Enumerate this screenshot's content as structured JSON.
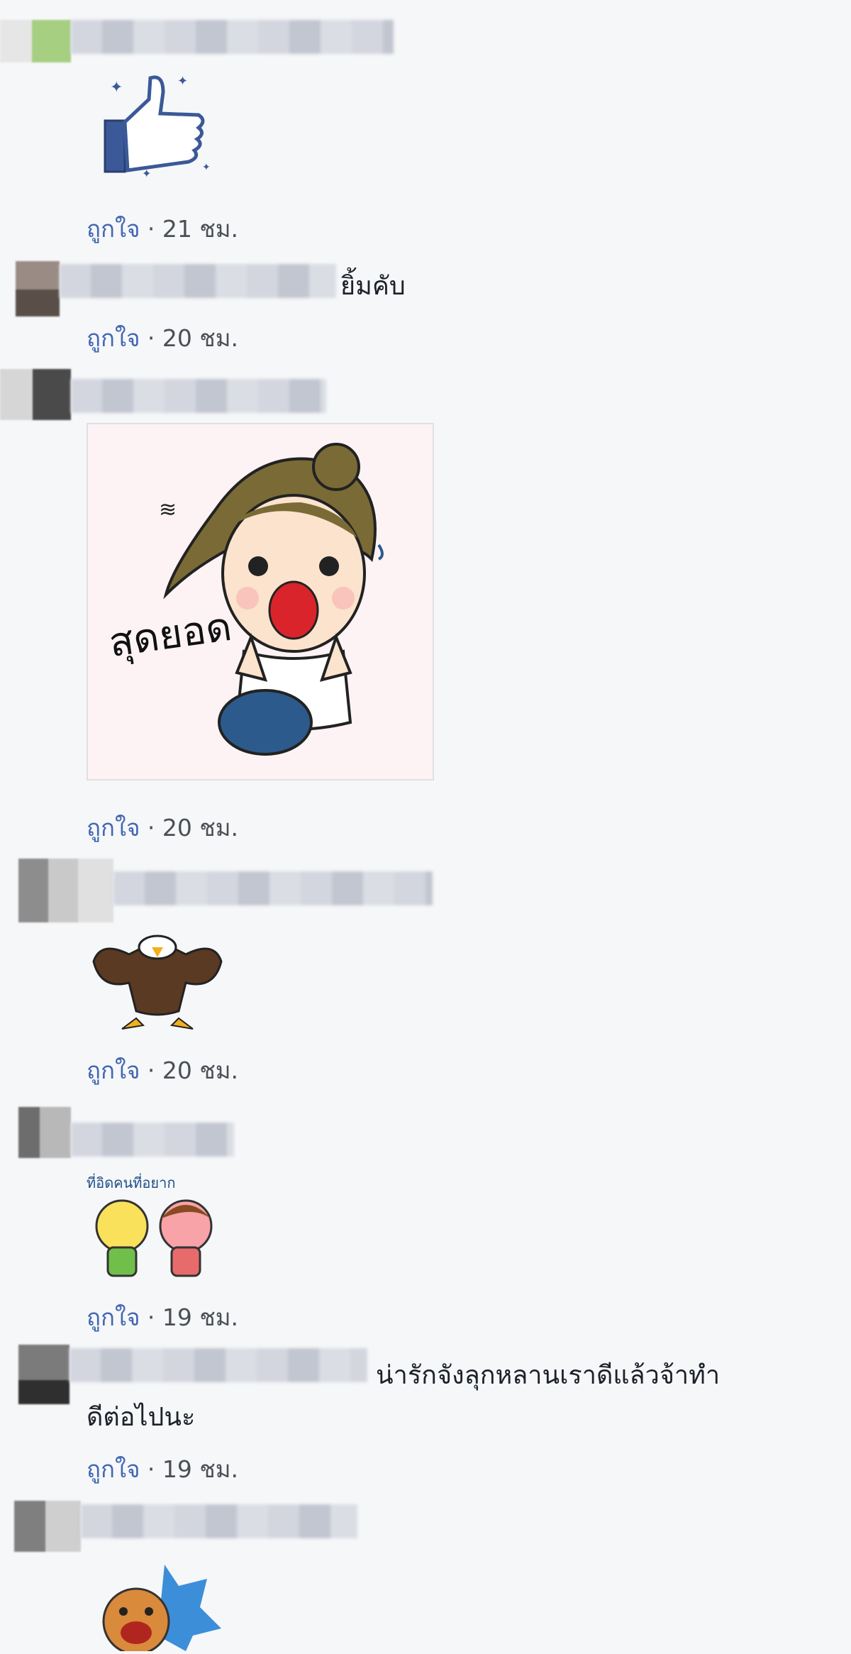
{
  "comments": [
    {
      "text": "",
      "like_label": "ถูกใจ",
      "time": "· 21 ชม.",
      "sticker": "thumbs-up-sticker"
    },
    {
      "text": "ยิ้มคับ",
      "like_label": "ถูกใจ",
      "time": "· 20 ชม."
    },
    {
      "text": "",
      "like_label": "ถูกใจ",
      "time": "· 20 ชม.",
      "sticker": "girl-thumbs-up-sticker",
      "sticker_text": "สุดยอด"
    },
    {
      "text": "",
      "like_label": "ถูกใจ",
      "time": "· 20 ชม.",
      "sticker": "eagle-flexing-sticker"
    },
    {
      "text": "",
      "like_label": "ถูกใจ",
      "time": "· 19 ชม.",
      "sticker": "two-kids-sticker",
      "sticker_text": "ที่อิดคนที่อยาก"
    },
    {
      "text": "น่ารักจังลุกหลานเราดีแล้วจ้าทำ",
      "text_line2": "ดีต่อไปนะ",
      "like_label": "ถูกใจ",
      "time": "· 19 ชม."
    },
    {
      "text": "",
      "sticker": "dog-star-sticker"
    }
  ],
  "colors": {
    "background": "#f6f7f9",
    "link": "#4267b2",
    "meta": "#4b4f56",
    "text": "#1d2129"
  }
}
